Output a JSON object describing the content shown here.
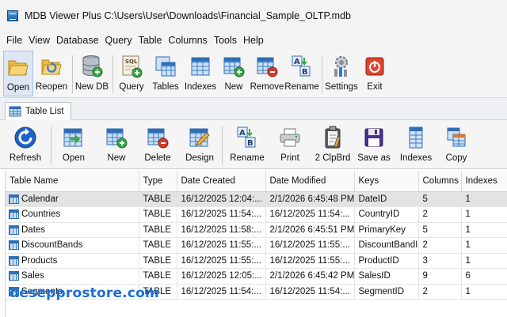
{
  "window": {
    "title": "MDB Viewer Plus C:\\Users\\User\\Downloads\\Financial_Sample_OLTP.mdb"
  },
  "menu": [
    "File",
    "View",
    "Database",
    "Query",
    "Table",
    "Columns",
    "Tools",
    "Help"
  ],
  "toolbar_main": {
    "open": "Open",
    "reopen": "Reopen",
    "new_db": "New DB",
    "query": "Query",
    "tables": "Tables",
    "indexes": "Indexes",
    "new": "New",
    "remove": "Remove",
    "rename": "Rename",
    "settings": "Settings",
    "exit": "Exit"
  },
  "tab": {
    "label": "Table List"
  },
  "toolbar_table": {
    "refresh": "Refresh",
    "open": "Open",
    "new": "New",
    "delete": "Delete",
    "design": "Design",
    "rename": "Rename",
    "print": "Print",
    "clipboard": "2 ClpBrd",
    "save_as": "Save as",
    "indexes": "Indexes",
    "copy": "Copy"
  },
  "table": {
    "columns": [
      "Table Name",
      "Type",
      "Date Created",
      "Date Modified",
      "Keys",
      "Columns",
      "Indexes"
    ],
    "rows": [
      [
        "Calendar",
        "TABLE",
        "16/12/2025 12:04:...",
        "2/1/2026 6:45:48 PM",
        "DateID",
        "5",
        "1"
      ],
      [
        "Countries",
        "TABLE",
        "16/12/2025 11:54:...",
        "16/12/2025 11:54:...",
        "CountryID",
        "2",
        "1"
      ],
      [
        "Dates",
        "TABLE",
        "16/12/2025 11:58:...",
        "2/1/2026 6:45:51 PM",
        "PrimaryKey",
        "5",
        "1"
      ],
      [
        "DiscountBands",
        "TABLE",
        "16/12/2025 11:55:...",
        "16/12/2025 11:55:...",
        "DiscountBandID",
        "2",
        "1"
      ],
      [
        "Products",
        "TABLE",
        "16/12/2025 11:55:...",
        "16/12/2025 11:55:...",
        "ProductID",
        "3",
        "1"
      ],
      [
        "Sales",
        "TABLE",
        "16/12/2025 12:05:...",
        "2/1/2026 6:45:42 PM",
        "SalesID",
        "9",
        "6"
      ],
      [
        "Segments",
        "TABLE",
        "16/12/2025 11:54:...",
        "16/12/2025 11:54:...",
        "SegmentID",
        "2",
        "1"
      ]
    ]
  },
  "watermark": "desepprostore.com"
}
